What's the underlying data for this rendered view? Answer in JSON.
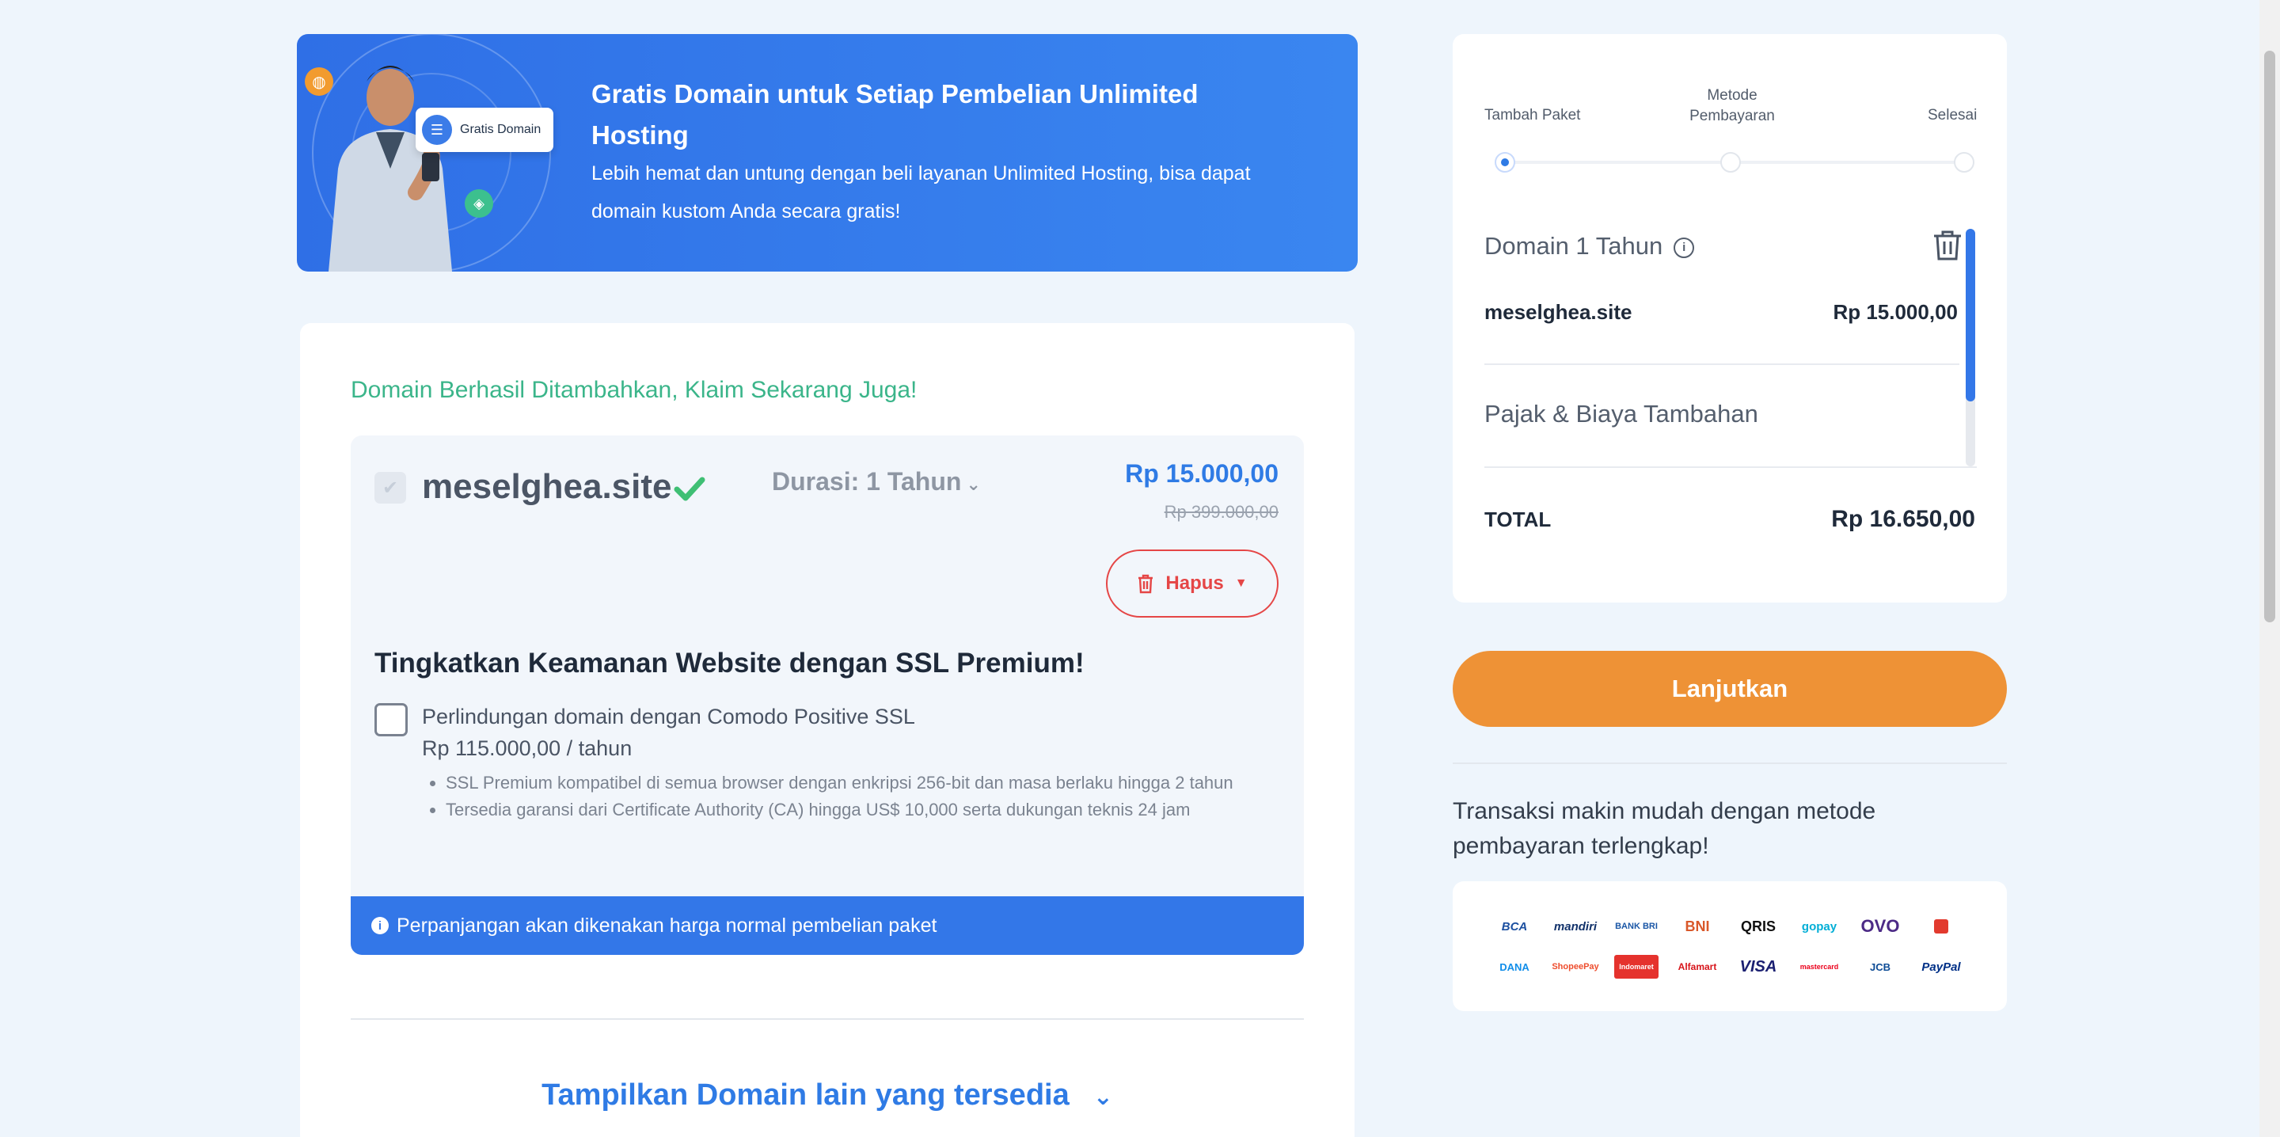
{
  "promo": {
    "badge_label": "Gratis Domain",
    "title": "Gratis Domain untuk Setiap Pembelian Unlimited Hosting",
    "subtitle": "Lebih hemat dan untung dengan beli layanan Unlimited Hosting, bisa dapat domain kustom Anda secara gratis!"
  },
  "domain_section": {
    "success_message": "Domain Berhasil Ditambahkan, Klaim Sekarang Juga!",
    "domain_name": "meselghea.site",
    "duration_label": "Durasi: 1 Tahun",
    "price": "Rp 15.000,00",
    "original_price": "Rp 399.000,00",
    "remove_label": "Hapus"
  },
  "ssl": {
    "title": "Tingkatkan Keamanan Website dengan SSL Premium!",
    "option_label": "Perlindungan domain dengan Comodo Positive SSL",
    "option_price": "Rp 115.000,00 / tahun",
    "features": [
      "SSL Premium kompatibel di semua browser dengan enkripsi 256-bit dan masa berlaku hingga 2 tahun",
      "Tersedia garansi dari Certificate Authority (CA) hingga US$ 10,000 serta dukungan teknis 24 jam"
    ]
  },
  "notice": "Perpanjangan akan dikenakan harga normal pembelian paket",
  "show_more": "Tampilkan Domain lain yang tersedia",
  "stepper": {
    "steps": [
      "Tambah Paket",
      "Metode Pembayaran",
      "Selesai"
    ],
    "active_index": 0
  },
  "summary": {
    "item_title": "Domain 1 Tahun",
    "item_domain": "meselghea.site",
    "item_price": "Rp 15.000,00",
    "tax_label": "Pajak & Biaya Tambahan",
    "total_label": "TOTAL",
    "total_value": "Rp 16.650,00"
  },
  "continue_label": "Lanjutkan",
  "payment": {
    "text": "Transaksi makin mudah dengan metode pembayaran terlengkap!",
    "logos": [
      {
        "name": "BCA",
        "color": "#1b4fa0"
      },
      {
        "name": "mandiri",
        "color": "#12326b"
      },
      {
        "name": "BANK BRI",
        "color": "#1a56a6"
      },
      {
        "name": "BNI",
        "color": "#d9582a"
      },
      {
        "name": "QRIS",
        "color": "#111111"
      },
      {
        "name": "gopay",
        "color": "#00aed6"
      },
      {
        "name": "OVO",
        "color": "#4c2a86"
      },
      {
        "name": "",
        "color": "#e23a2e"
      },
      {
        "name": "DANA",
        "color": "#118ee9"
      },
      {
        "name": "ShopeePay",
        "color": "#ee4d2d"
      },
      {
        "name": "Indomaret",
        "color": "#e5322d"
      },
      {
        "name": "Alfamart",
        "color": "#d7141a"
      },
      {
        "name": "VISA",
        "color": "#1a1f71"
      },
      {
        "name": "mastercard",
        "color": "#eb001b"
      },
      {
        "name": "JCB",
        "color": "#0e4c96"
      },
      {
        "name": "PayPal",
        "color": "#003087"
      }
    ]
  },
  "colors": {
    "primary": "#2f7be5",
    "success": "#3bb58a",
    "danger": "#e54646",
    "accent": "#ee9236",
    "background": "#eef5fc"
  }
}
